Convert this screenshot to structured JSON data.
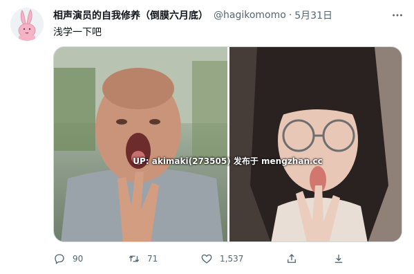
{
  "tweet": {
    "display_name": "相声演员的自我修养（倒膜六月底）",
    "handle": "@hagikomomo",
    "separator": "·",
    "time": "5月31日",
    "text": "浅学一下吧",
    "media_watermark": "UP: akimaki(273505) 发布于 mengzhan.cc",
    "actions": {
      "reply_count": "90",
      "retweet_count": "71",
      "like_count": "1,537"
    }
  },
  "icons": {
    "more": "more-icon",
    "reply": "reply-icon",
    "retweet": "retweet-icon",
    "like": "heart-icon",
    "share": "share-icon",
    "download": "download-icon"
  },
  "colors": {
    "text": "#0f1419",
    "secondary_text": "#536471",
    "border": "#cfd9de",
    "avatar_pink": "#f6b3c7"
  }
}
